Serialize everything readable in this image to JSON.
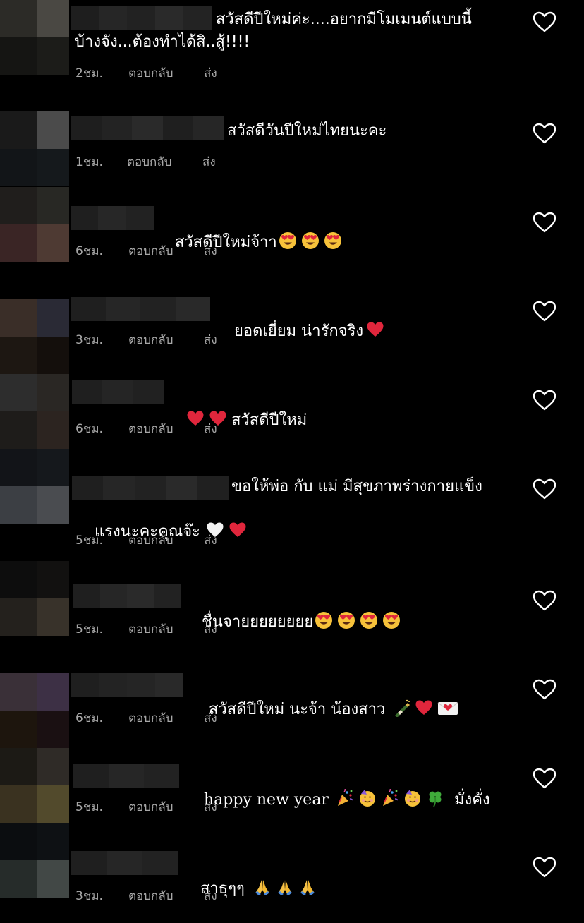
{
  "comments": [
    {
      "text": "สวัสดีปีใหม่ค่ะ....อยากมีโมเมนต์แบบนี้",
      "text2": "บ้างจัง...ต้องทำได้สิ..สู้!!!!",
      "time": "2ชม.",
      "reply": "ตอบกลับ",
      "send": "ส่ง"
    },
    {
      "text": "สวัสดีวันปีใหม่ไทยนะคะ",
      "time": "1ชม.",
      "reply": "ตอบกลับ",
      "send": "ส่ง"
    },
    {
      "text": "สวัสดีปีใหม่จ้าา",
      "emoji": [
        "heart-eyes",
        "heart-eyes",
        "heart-eyes"
      ],
      "time": "6ชม.",
      "reply": "ตอบกลับ",
      "send": "ส่ง"
    },
    {
      "text": "ยอดเยี่ยม น่ารักจริง",
      "emoji_after": [
        "red-heart"
      ],
      "time": "3ชม.",
      "reply": "ตอบกลับ",
      "send": "ส่ง"
    },
    {
      "text": "สวัสดีปีใหม่",
      "emoji_before": [
        "red-heart",
        "red-heart"
      ],
      "time": "6ชม.",
      "reply": "ตอบกลับ",
      "send": "ส่ง"
    },
    {
      "text": "ขอให้พ่อ กับ แม่ มีสุขภาพร่างกายแข็ง",
      "text2": "แรงนะคะคุณจ๊ะ",
      "emoji2": [
        "white-heart",
        "red-heart"
      ],
      "time": "5ชม.",
      "reply": "ตอบกลับ",
      "send": "ส่ง"
    },
    {
      "text": "ชื่นจายยยยยยยย",
      "emoji": [
        "heart-eyes",
        "heart-eyes",
        "heart-eyes",
        "heart-eyes"
      ],
      "time": "5ชม.",
      "reply": "ตอบกลับ",
      "send": "ส่ง"
    },
    {
      "text": "สวัสดีปีใหม่ นะจ้า น้องสาว",
      "emoji": [
        "bottle",
        "red-heart",
        "love-letter"
      ],
      "time": "6ชม.",
      "reply": "ตอบกลับ",
      "send": "ส่ง"
    },
    {
      "text": "happy new year",
      "emoji": [
        "party-popper",
        "partying-face",
        "party-popper",
        "partying-face",
        "clover"
      ],
      "text_after": "มั่งคั่ง",
      "time": "5ชม.",
      "reply": "ตอบกลับ",
      "send": "ส่ง"
    },
    {
      "text": "สาธุๆๆ",
      "emoji": [
        "pray",
        "pray",
        "pray"
      ],
      "time": "3ชม.",
      "reply": "ตอบกลับ",
      "send": "ส่ง"
    }
  ],
  "colors": {
    "background": "#000000",
    "meta": "#a8a8a8",
    "red_heart": "#e0263c"
  }
}
